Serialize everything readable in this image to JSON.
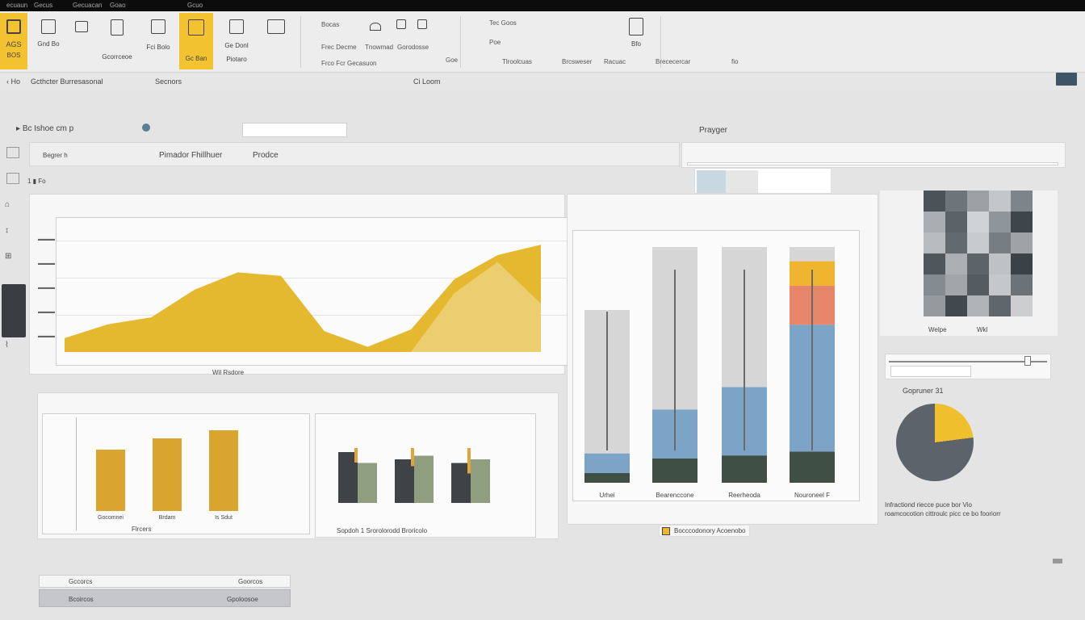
{
  "window": {
    "menu": [
      "ecuaun",
      "Gecus",
      "Gecuacan",
      "Goao",
      "Gcuo"
    ]
  },
  "ribbon": {
    "groups": [
      {
        "labels": [
          "AGS",
          "BOS"
        ]
      },
      {
        "labels": [
          "Gnd Bo",
          "Fci Bolo"
        ]
      },
      {
        "labels": [
          "Gcorrceoe"
        ]
      },
      {
        "labels": [
          "Ge Donl",
          "Piotaro"
        ]
      },
      {
        "labels": [
          "Gc Ban"
        ]
      }
    ],
    "text_items": [
      "Bocas",
      "Frec Decme",
      "Tnowmad",
      "Gorodosse",
      "Frco Fcr Gecasuon",
      "Goe",
      "Tec Goos",
      "Poe",
      "Tlroolcuas",
      "Brcsweser",
      "Racuac",
      "Bfo",
      "Brececercar",
      "fio"
    ],
    "accent": "#f2c230"
  },
  "breadcrumb": {
    "back": "Ho",
    "path": "Gcthcter Burresasonal",
    "view": "Secnors",
    "center": "Ci Loom",
    "filter_label": "Bc Ishoe cm p"
  },
  "filter_bar": {
    "label1": "Begrer h",
    "label2": "Pimador Fhillhuer",
    "label3": "Prodce"
  },
  "preview": {
    "title": "Prayger",
    "footer": "Welpe",
    "footer_right": "Wkl"
  },
  "slider": {
    "label": "Gopruner",
    "value": "31"
  },
  "pie_chart": {
    "caption": "Infractiond riecce puce bor Vio roamcocotion cittroulc picc ce bo fooriorr"
  },
  "area_chart_title": "Wil Rsdore",
  "small_bar_title": "Flrcers",
  "bottom_legend": {
    "text": "Sopdoh 1 Srorolorodd Broricolo"
  },
  "stacked_legend": {
    "text": "Bocccodonory Acoenobo"
  },
  "footer_tabs": [
    "Gccorcs",
    "Goorcos",
    "Bcoircos",
    "Gpoloosoe"
  ],
  "chart_data": [
    {
      "type": "area",
      "series": [
        {
          "values": [
            8,
            16,
            20,
            36,
            46,
            44,
            12,
            3,
            13,
            42,
            56,
            62
          ]
        },
        {
          "values": [
            0,
            0,
            0,
            0,
            0,
            0,
            0,
            0,
            0,
            34,
            52,
            28
          ]
        }
      ],
      "ylim": [
        0,
        70
      ],
      "colors": [
        "#e4b930",
        "#f0d68a"
      ]
    },
    {
      "type": "bar",
      "categories": [
        "Gocomnei",
        "Brdam",
        "Is Sdut"
      ],
      "values": [
        38,
        45,
        50
      ],
      "ylim": [
        0,
        55
      ],
      "color": "#d9a52e"
    },
    {
      "type": "bar",
      "series": [
        {
          "values": [
            70,
            60,
            55
          ],
          "color": "#3f4347"
        },
        {
          "values": [
            55,
            65,
            60
          ],
          "color": "#8f9e7f"
        },
        {
          "values": [
            20,
            25,
            35
          ],
          "color": "#e0a43a"
        }
      ],
      "ylim": [
        0,
        100
      ]
    },
    {
      "type": "bar",
      "categories": [
        "Urhei",
        "Bearenccone",
        "Reerheoda",
        "Nouroneel F"
      ],
      "series": [
        {
          "name": "",
          "values": [
            10,
            25,
            28,
            32
          ],
          "color": "#3f4f45"
        },
        {
          "name": "",
          "values": [
            20,
            50,
            70,
            130
          ],
          "color": "#7ba4c7"
        },
        {
          "name": "",
          "values": [
            0,
            0,
            0,
            40
          ],
          "color": "#e8866c"
        },
        {
          "name": "",
          "values": [
            0,
            0,
            0,
            25
          ],
          "color": "#f0b52e"
        }
      ],
      "ylim": [
        0,
        240
      ]
    }
  ]
}
